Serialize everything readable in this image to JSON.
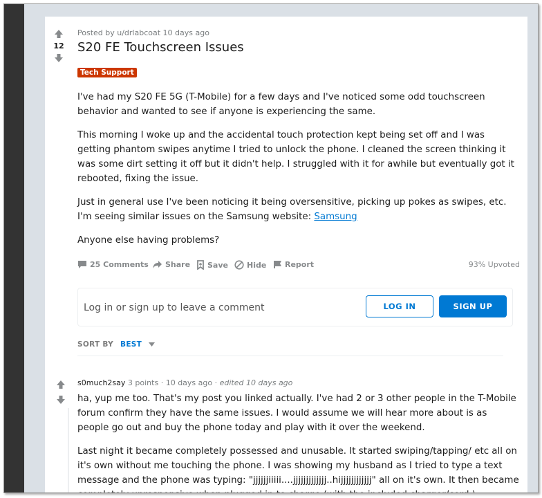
{
  "post": {
    "score": "12",
    "meta": "Posted by u/drlabcoat 10 days ago",
    "title": "S20 FE Touchscreen Issues",
    "flair": "Tech Support",
    "paragraphs": [
      "I've had my S20 FE 5G (T-Mobile) for a few days and I've noticed some odd touchscreen behavior and wanted to see if anyone is experiencing the same.",
      "This morning I woke up and the accidental touch protection kept being set off and I was getting phantom swipes anytime I tried to unlock the phone. I cleaned the screen thinking it was some dirt setting it off but it didn't help. I struggled with it for awhile but eventually got it rebooted, fixing the issue.",
      "Just in general use I've been noticing it being oversensitive, picking up pokes as swipes, etc. I'm seeing similar issues on the Samsung website:",
      "Anyone else having problems?"
    ],
    "link_text": "Samsung"
  },
  "actions": {
    "comments": "25 Comments",
    "share": "Share",
    "save": "Save",
    "hide": "Hide",
    "report": "Report",
    "upvoted": "93% Upvoted"
  },
  "comment_box": {
    "prompt": "Log in or sign up to leave a comment",
    "login": "LOG IN",
    "signup": "SIGN UP"
  },
  "sort": {
    "label": "SORT BY",
    "value": "BEST"
  },
  "comment": {
    "author": "s0much2say",
    "points": "3 points",
    "time": "10 days ago",
    "edited": "edited 10 days ago",
    "paragraphs": [
      "ha, yup me too. That's my post you linked actually. I've had 2 or 3 other people in the T-Mobile forum confirm they have the same issues. I would assume we will hear more about is as people go out and buy the phone today and play with it over the weekend.",
      "Last night it became completely possessed and unusable. It started swiping/tapping/ etc all on it's own without me touching the phone. I was showing my husband as I tried to type a text message and the phone was typing: \"jjjjjjiiiii....jjjjjjjjjjjjj..hijjjjjjjjjjjj\" all on it's own. It then became completely unresponsive when plugged in to charge (with the included charger/cord.)"
    ]
  },
  "colors": {
    "accent": "#0079d3",
    "flair": "#cc3700",
    "muted": "#878a8c"
  }
}
